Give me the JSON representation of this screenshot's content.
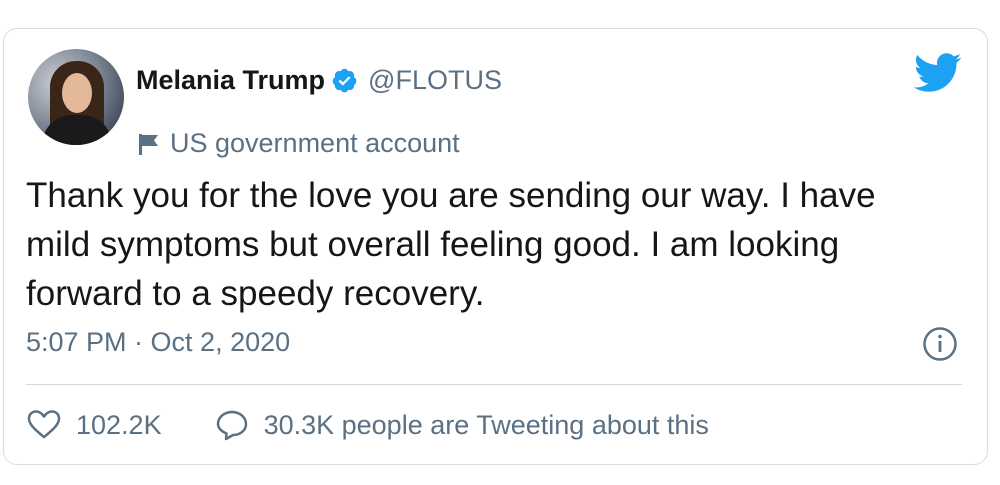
{
  "user": {
    "display_name": "Melania Trump",
    "handle": "@FLOTUS",
    "label": "US government account",
    "verified": true
  },
  "tweet": {
    "text_lines": [
      "Thank you for the love you are sending our way. I have",
      "mild symptoms but overall feeling good. I am looking",
      "forward to a speedy recovery."
    ],
    "timestamp": "5:07 PM · Oct 2, 2020"
  },
  "actions": {
    "likes": "102.2K",
    "replies_text": "30.3K people are Tweeting about this"
  },
  "icons": [
    "verified-badge-icon",
    "flag-icon",
    "twitter-bird-icon",
    "info-icon",
    "heart-icon",
    "speech-bubble-icon"
  ],
  "colors": {
    "brand_blue": "#1da1f2",
    "secondary_text": "#5b7083",
    "primary_text": "#14171a",
    "border": "#d6dde3"
  }
}
